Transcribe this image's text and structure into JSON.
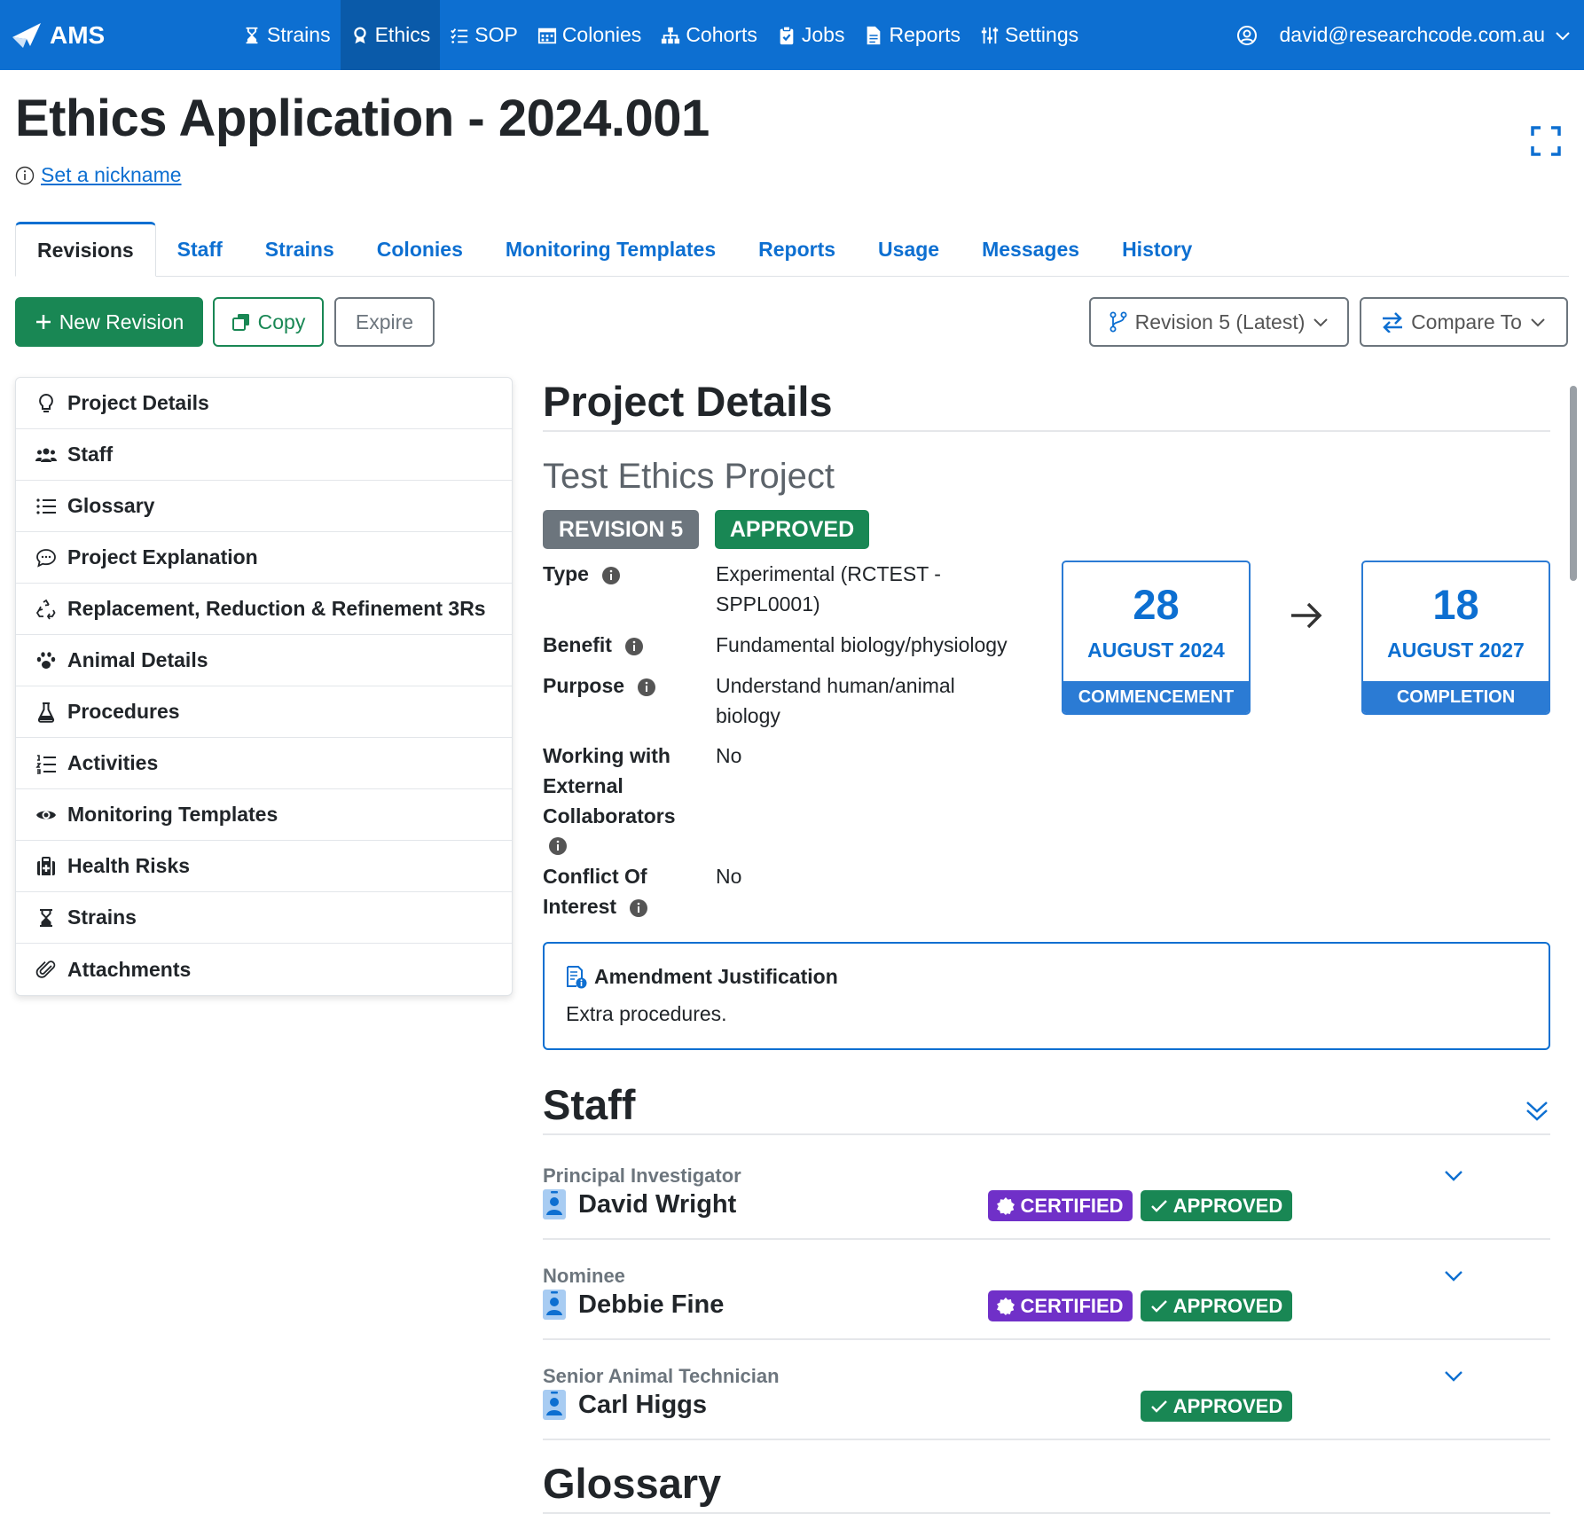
{
  "app": {
    "name": "AMS"
  },
  "nav": {
    "items": [
      {
        "label": "Strains",
        "icon": "hourglass-icon"
      },
      {
        "label": "Ethics",
        "icon": "ribbon-icon",
        "active": true
      },
      {
        "label": "SOP",
        "icon": "list-check-icon"
      },
      {
        "label": "Colonies",
        "icon": "calendar-grid-icon"
      },
      {
        "label": "Cohorts",
        "icon": "sitemap-icon"
      },
      {
        "label": "Jobs",
        "icon": "clipboard-check-icon"
      },
      {
        "label": "Reports",
        "icon": "file-icon"
      },
      {
        "label": "Settings",
        "icon": "sliders-icon"
      }
    ],
    "user_email": "david@researchcode.com.au"
  },
  "header": {
    "title": "Ethics Application - 2024.001",
    "nickname_link": "Set a nickname"
  },
  "tabs": [
    "Revisions",
    "Staff",
    "Strains",
    "Colonies",
    "Monitoring Templates",
    "Reports",
    "Usage",
    "Messages",
    "History"
  ],
  "toolbar": {
    "new_revision": "New Revision",
    "copy": "Copy",
    "expire": "Expire",
    "revision_select": "Revision 5 (Latest)",
    "compare_to": "Compare To"
  },
  "sidebar": {
    "items": [
      {
        "label": "Project Details",
        "icon": "lightbulb-icon"
      },
      {
        "label": "Staff",
        "icon": "users-icon"
      },
      {
        "label": "Glossary",
        "icon": "list-icon"
      },
      {
        "label": "Project Explanation",
        "icon": "speech-bubble-icon"
      },
      {
        "label": "Replacement, Reduction & Refinement 3Rs",
        "icon": "recycle-icon"
      },
      {
        "label": "Animal Details",
        "icon": "paw-icon"
      },
      {
        "label": "Procedures",
        "icon": "flask-icon"
      },
      {
        "label": "Activities",
        "icon": "ordered-list-icon"
      },
      {
        "label": "Monitoring Templates",
        "icon": "eye-icon"
      },
      {
        "label": "Health Risks",
        "icon": "medkit-icon"
      },
      {
        "label": "Strains",
        "icon": "hourglass-icon"
      },
      {
        "label": "Attachments",
        "icon": "paperclip-icon"
      }
    ]
  },
  "project": {
    "section_title": "Project Details",
    "name": "Test Ethics Project",
    "revision_badge": "REVISION 5",
    "status_badge": "APPROVED",
    "fields": {
      "type_label": "Type",
      "type_value_line1": "Experimental (RCTEST -",
      "type_value_line2": "SPPL0001)",
      "benefit_label": "Benefit",
      "benefit_value": "Fundamental biology/physiology",
      "purpose_label": "Purpose",
      "purpose_value_line1": "Understand human/animal",
      "purpose_value_line2": "biology",
      "external_label_line1": "Working with",
      "external_label_line2": "External",
      "external_label_line3": "Collaborators",
      "external_value": "No",
      "conflict_label_line1": "Conflict Of",
      "conflict_label_line2": "Interest",
      "conflict_value": "No"
    },
    "commencement": {
      "day": "28",
      "month": "AUGUST 2024",
      "label": "COMMENCEMENT"
    },
    "completion": {
      "day": "18",
      "month": "AUGUST 2027",
      "label": "COMPLETION"
    },
    "amendment": {
      "title": "Amendment Justification",
      "text": "Extra procedures."
    }
  },
  "staff": {
    "section_title": "Staff",
    "members": [
      {
        "role": "Principal Investigator",
        "name": "David Wright",
        "certified": "CERTIFIED",
        "approved": "APPROVED"
      },
      {
        "role": "Nominee",
        "name": "Debbie Fine",
        "certified": "CERTIFIED",
        "approved": "APPROVED"
      },
      {
        "role": "Senior Animal Technician",
        "name": "Carl Higgs",
        "approved": "APPROVED"
      }
    ]
  },
  "glossary": {
    "section_title": "Glossary"
  },
  "colors": {
    "primary": "#0d6fd1",
    "success": "#198754",
    "secondary": "#6c757d",
    "certified": "#7030c8"
  }
}
